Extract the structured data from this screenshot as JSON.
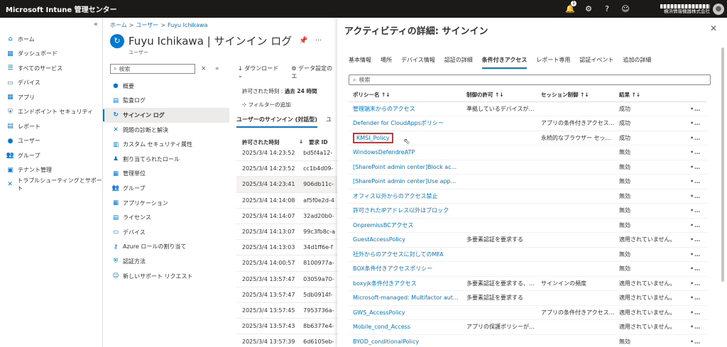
{
  "topbar": {
    "title": "Microsoft Intune 管理センター",
    "notification_count": "1",
    "account_org": "横浜情報機器株式会社"
  },
  "leftnav": {
    "collapse": "«",
    "items": [
      {
        "label": "ホーム",
        "icon": "home-icon"
      },
      {
        "label": "ダッシュボード",
        "icon": "dashboard-icon"
      },
      {
        "label": "すべてのサービス",
        "icon": "list-icon"
      },
      {
        "label": "デバイス",
        "icon": "device-icon"
      },
      {
        "label": "アプリ",
        "icon": "apps-icon"
      },
      {
        "label": "エンドポイント セキュリティ",
        "icon": "shield-icon"
      },
      {
        "label": "レポート",
        "icon": "report-icon"
      },
      {
        "label": "ユーザー",
        "icon": "user-icon"
      },
      {
        "label": "グループ",
        "icon": "group-icon"
      },
      {
        "label": "テナント管理",
        "icon": "tenant-icon"
      },
      {
        "label": "トラブルシューティングとサポート",
        "icon": "wrench-icon"
      }
    ]
  },
  "blade": {
    "breadcrumb": [
      "ホーム",
      "ユーザー",
      "Fuyu Ichikawa"
    ],
    "title": "Fuyu Ichikawa | サインイン ログ",
    "subtitle": "ユーザー",
    "search_placeholder": "検索",
    "menu": [
      {
        "label": "概要",
        "icon": "user-icon"
      },
      {
        "label": "監査ログ",
        "icon": "audit-icon"
      },
      {
        "label": "サインイン ログ",
        "icon": "signin-icon",
        "active": true
      },
      {
        "label": "問題の診断と解決",
        "icon": "wrench-icon"
      },
      {
        "label": "カスタム セキュリティ属性",
        "icon": "security-attr-icon"
      },
      {
        "label": "割り当てられたロール",
        "icon": "role-icon"
      },
      {
        "label": "管理単位",
        "icon": "admin-unit-icon"
      },
      {
        "label": "グループ",
        "icon": "group-icon"
      },
      {
        "label": "アプリケーション",
        "icon": "apps-icon"
      },
      {
        "label": "ライセンス",
        "icon": "license-icon"
      },
      {
        "label": "デバイス",
        "icon": "device-icon"
      },
      {
        "label": "Azure ロールの割り当て",
        "icon": "key-icon"
      },
      {
        "label": "認証方法",
        "icon": "auth-icon"
      },
      {
        "label": "新しいサポート リクエスト",
        "icon": "support-icon"
      }
    ],
    "toolbar": {
      "download": "ダウンロード",
      "settings": "データ設定のエ"
    },
    "time_label": "許可された時刻 :",
    "time_value": "過去 24 時間",
    "add_filter": "フィルターの追加",
    "tab1": "ユーザーのサインイン (対話型)",
    "tab2": "ユ",
    "col_time": "許可された時刻",
    "col_id": "要求 ID",
    "rows": [
      {
        "time": "2025/3/4 14:23:52",
        "id": "bd5f4a12-"
      },
      {
        "time": "2025/3/4 14:23:52",
        "id": "cc1b4d09-"
      },
      {
        "time": "2025/3/4 14:23:41",
        "id": "906db11c-"
      },
      {
        "time": "2025/3/4 14:14:08",
        "id": "af5f0e2d-4"
      },
      {
        "time": "2025/3/4 14:14:07",
        "id": "32ad20b0-"
      },
      {
        "time": "2025/3/4 14:13:07",
        "id": "99c3fb8c-a"
      },
      {
        "time": "2025/3/4 14:13:03",
        "id": "34d1ff6e-f"
      },
      {
        "time": "2025/3/4 14:00:57",
        "id": "8100977a-"
      },
      {
        "time": "2025/3/4 13:57:47",
        "id": "03059a70-"
      },
      {
        "time": "2025/3/4 13:57:47",
        "id": "5db0914f-"
      },
      {
        "time": "2025/3/4 13:57:45",
        "id": "7953736a-"
      },
      {
        "time": "2025/3/4 13:57:43",
        "id": "8b6377e4-"
      },
      {
        "time": "2025/3/4 13:57:39",
        "id": "6d6105eb-"
      }
    ]
  },
  "pane": {
    "title": "アクティビティの詳細: サインイン",
    "tabs": [
      "基本情報",
      "場所",
      "デバイス情報",
      "認証の詳細",
      "条件付きアクセス",
      "レポート専用",
      "認証イベント",
      "追加の詳細"
    ],
    "active_tab": 4,
    "search_placeholder": "検索",
    "headers": [
      "ポリシー名 ↑↓",
      "制御の許可 ↑↓",
      "セッション制御 ↑↓",
      "結果 ↑↓"
    ],
    "more": "•••",
    "rows": [
      {
        "name": "管理端末からのアクセス",
        "grant": "準拠しているデバイスが必要...",
        "session": "",
        "result": "成功"
      },
      {
        "name": "Defender for CloudAppsポリシー",
        "grant": "",
        "session": "アプリの条件付きアクセス制...",
        "result": "成功"
      },
      {
        "name": "KMSI_Policy",
        "grant": "",
        "session": "永続的なブラウザー セッション",
        "result": "成功",
        "highlight": true
      },
      {
        "name": "WindowsDefendreATP",
        "grant": "",
        "session": "",
        "result": "無効"
      },
      {
        "name": "[SharePoint admin center]Block ac...",
        "grant": "",
        "session": "",
        "result": "無効"
      },
      {
        "name": "[SharePoint admin center]Use app...",
        "grant": "",
        "session": "",
        "result": "無効"
      },
      {
        "name": "オフィス以外からのアクセス禁止",
        "grant": "",
        "session": "",
        "result": "無効"
      },
      {
        "name": "許可されたIPアドレス以外はブロック",
        "grant": "",
        "session": "",
        "result": "無効"
      },
      {
        "name": "OnpremissBCアクセス",
        "grant": "",
        "session": "",
        "result": "無効"
      },
      {
        "name": "GuestAccessPolicy",
        "grant": "多要素認証を要求する",
        "session": "",
        "result": "適用されていません。"
      },
      {
        "name": "社外からのアクセスに対してのMFA",
        "grant": "",
        "session": "",
        "result": "無効"
      },
      {
        "name": "BOX条件付きアクセスポリシー",
        "grant": "",
        "session": "",
        "result": "無効"
      },
      {
        "name": "boxyjk条件付きアクセス",
        "grant": "多要素認証を要求する、準...",
        "session": "サインインの頻度",
        "result": "適用されていません。"
      },
      {
        "name": "Microsoft-managed: Multifactor aut...",
        "grant": "多要素認証を要求する",
        "session": "",
        "result": "適用されていません。"
      },
      {
        "name": "GWS_AccessPolicy",
        "grant": "",
        "session": "アプリの条件付きアクセス制...",
        "result": "適用されていません。"
      },
      {
        "name": "Mobile_cond_Access",
        "grant": "アプリの保護ポリシーが必要",
        "session": "",
        "result": "適用されていません。"
      },
      {
        "name": "BYOD_conditionalPolicy",
        "grant": "",
        "session": "",
        "result": "無効"
      }
    ]
  }
}
